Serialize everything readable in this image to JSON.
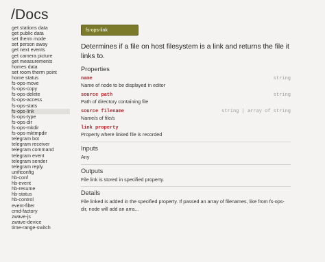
{
  "page": {
    "title": "/Docs"
  },
  "sidebar": {
    "items": [
      "get stations data",
      "get public data",
      "set therm mode",
      "set person away",
      "get next events",
      "get camera picture",
      "get measurements",
      "homes data",
      "set room therm point",
      "home status",
      "fs-ops-move",
      "fs-ops-copy",
      "fs-ops-delete",
      "fs-ops-access",
      "fs-ops-stats",
      "fs-ops-link",
      "fs-ops-type",
      "fs-ops-dir",
      "fs-ops-mkdir",
      "fs-ops-mktmpdir",
      "telegram bot",
      "telegram receiver",
      "telegram command",
      "telegram event",
      "telegram sender",
      "telegram reply",
      "unificonfig",
      "hb-conf",
      "hb-event",
      "hb-resume",
      "hb-status",
      "hb-control",
      "event-filter",
      "cmd-factory",
      "zwave-js",
      "zwave-device",
      "time-range-switch"
    ],
    "active": "fs-ops-link"
  },
  "node": {
    "label": "fs-ops-link"
  },
  "summary": "Determines if a file on host filesystem is a link and returns the file it links to.",
  "properties": {
    "title": "Properties",
    "items": [
      {
        "name": "name",
        "type": "string",
        "desc": "Name of node to be displayed in editor"
      },
      {
        "name": "source path",
        "type": "string",
        "desc": "Path of directory containing file"
      },
      {
        "name": "source filename",
        "type": "string | array of string",
        "desc": "Name/s of file/s"
      },
      {
        "name": "link property",
        "type": "",
        "desc": "Property where linked file is recorded"
      }
    ]
  },
  "inputs": {
    "title": "Inputs",
    "text": "Any"
  },
  "outputs": {
    "title": "Outputs",
    "text": "File link is stored in specified property."
  },
  "details": {
    "title": "Details",
    "text": "File linked is added in the specified property. If passed an array of filenames, like from fs-ops-dir, node will add an arra..."
  }
}
